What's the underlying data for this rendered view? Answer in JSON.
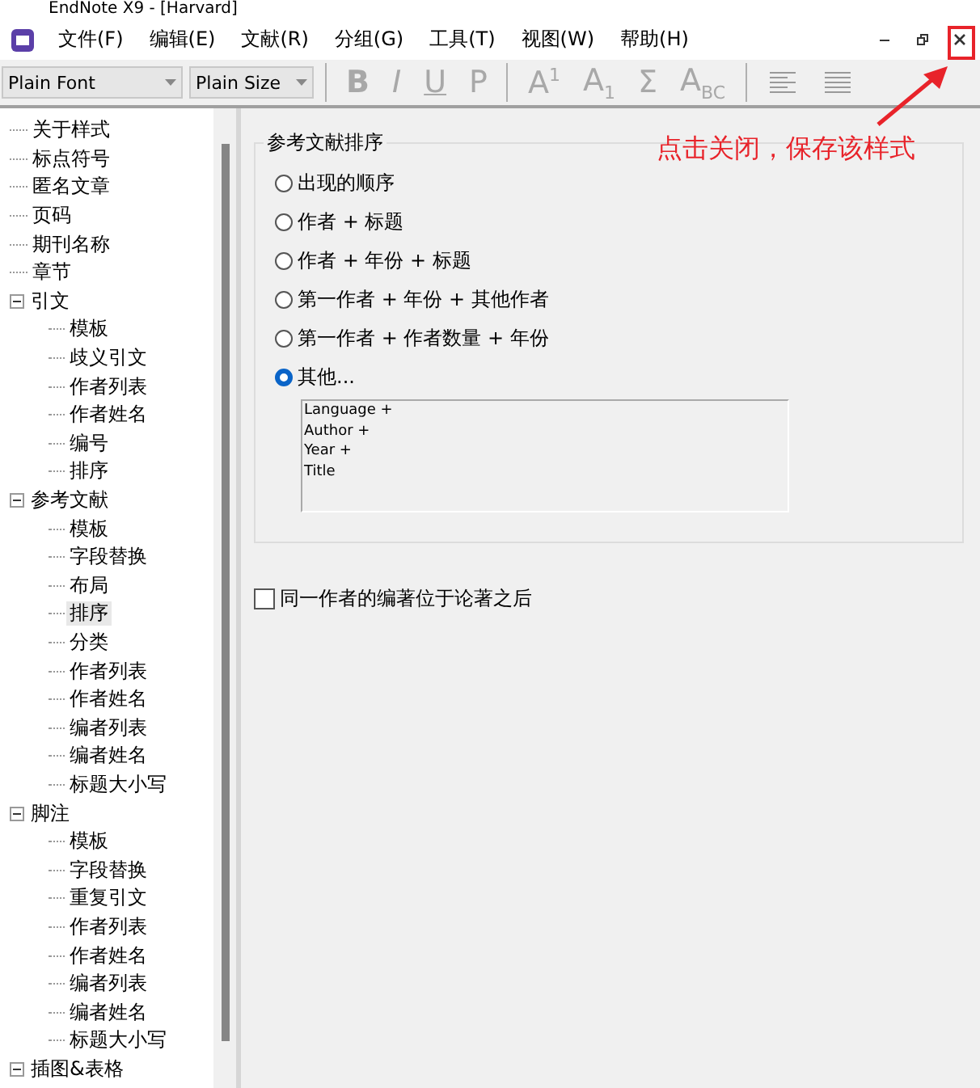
{
  "window": {
    "title": "EndNote X9 - [Harvard]"
  },
  "menu": [
    "文件(F)",
    "编辑(E)",
    "文献(R)",
    "分组(G)",
    "工具(T)",
    "视图(W)",
    "帮助(H)"
  ],
  "toolbar": {
    "font": "Plain Font",
    "size": "Plain Size",
    "format_buttons": [
      {
        "label": "B",
        "kind": "bold",
        "disabled": true
      },
      {
        "label": "I",
        "kind": "italic",
        "disabled": true
      },
      {
        "label": "U",
        "kind": "underline",
        "disabled": true
      },
      {
        "label": "P",
        "kind": "plain",
        "disabled": true
      },
      {
        "label": "A$^{1}$",
        "kind": "plain",
        "disabled": true
      },
      {
        "label": "A$_{1}$",
        "kind": "plain",
        "disabled": true
      },
      {
        "label": "Σ",
        "kind": "plain",
        "disabled": true
      },
      {
        "label": "A$_{BC}$",
        "kind": "plain",
        "disabled": true
      }
    ]
  },
  "tree": [
    {
      "label": "关于样式",
      "selected": false
    },
    {
      "label": "标点符号",
      "selected": false
    },
    {
      "label": "匿名文章",
      "selected": false
    },
    {
      "label": "页码",
      "selected": false
    },
    {
      "label": "期刊名称",
      "selected": false
    },
    {
      "label": "章节",
      "selected": false
    },
    {
      "label": "引文",
      "selected": false,
      "expanded": true,
      "children": [
        {
          "label": "模板",
          "selected": false
        },
        {
          "label": "歧义引文",
          "selected": false
        },
        {
          "label": "作者列表",
          "selected": false
        },
        {
          "label": "作者姓名",
          "selected": false
        },
        {
          "label": "编号",
          "selected": false
        },
        {
          "label": "排序",
          "selected": false
        }
      ]
    },
    {
      "label": "参考文献",
      "selected": false,
      "expanded": true,
      "children": [
        {
          "label": "模板",
          "selected": false
        },
        {
          "label": "字段替换",
          "selected": false
        },
        {
          "label": "布局",
          "selected": false
        },
        {
          "label": "排序",
          "selected": true
        },
        {
          "label": "分类",
          "selected": false
        },
        {
          "label": "作者列表",
          "selected": false
        },
        {
          "label": "作者姓名",
          "selected": false
        },
        {
          "label": "编者列表",
          "selected": false
        },
        {
          "label": "编者姓名",
          "selected": false
        },
        {
          "label": "标题大小写",
          "selected": false
        }
      ]
    },
    {
      "label": "脚注",
      "selected": false,
      "expanded": true,
      "children": [
        {
          "label": "模板",
          "selected": false
        },
        {
          "label": "字段替换",
          "selected": false
        },
        {
          "label": "重复引文",
          "selected": false
        },
        {
          "label": "作者列表",
          "selected": false
        },
        {
          "label": "作者姓名",
          "selected": false
        },
        {
          "label": "编者列表",
          "selected": false
        },
        {
          "label": "编者姓名",
          "selected": false
        },
        {
          "label": "标题大小写",
          "selected": false
        }
      ]
    },
    {
      "label": "插图&表格",
      "selected": false,
      "expanded": true
    }
  ],
  "sort_group": {
    "title": "参考文献排序",
    "options": [
      {
        "label": "出现的顺序",
        "selected": false
      },
      {
        "label": "作者 + 标题",
        "selected": false
      },
      {
        "label": "作者 + 年份 + 标题",
        "selected": false
      },
      {
        "label": "第一作者 + 年份 + 其他作者",
        "selected": false
      },
      {
        "label": "第一作者 + 作者数量 + 年份",
        "selected": false
      },
      {
        "label": "其他...",
        "selected": true
      }
    ],
    "custom_order": "Language +\nAuthor +\nYear +\nTitle"
  },
  "option_checkbox": {
    "label": "同一作者的编著位于论著之后",
    "checked": false
  },
  "annotation": {
    "text": "点击关闭，保存该样式"
  }
}
